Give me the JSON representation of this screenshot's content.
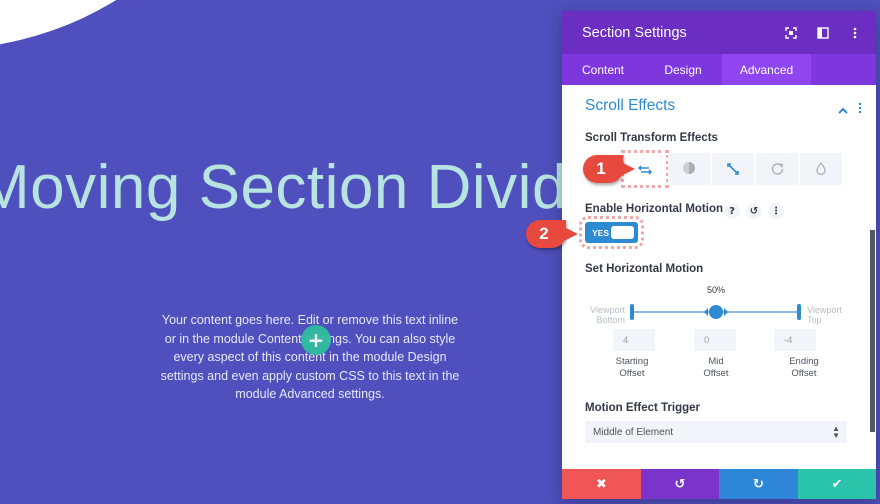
{
  "canvas": {
    "hero_title": "Moving Section Divide",
    "body_text": "Your content goes here. Edit or remove this text inline or in the module Content settings. You can also style every aspect of this content in the module Design settings and even apply custom CSS to this text in the module Advanced settings.",
    "add_icon": "plus-icon",
    "colors": {
      "background": "#4f4fbd",
      "title": "#b7e3e0"
    }
  },
  "panel": {
    "title": "Section Settings",
    "header_icons": [
      "expand-icon",
      "sidebar-layout-icon",
      "more-vertical-icon"
    ],
    "tabs": [
      {
        "label": "Content",
        "active": false
      },
      {
        "label": "Design",
        "active": false
      },
      {
        "label": "Advanced",
        "active": true
      }
    ],
    "section_title": "Scroll Effects",
    "scroll_transform_label": "Scroll Transform Effects",
    "effects": [
      {
        "name": "horizontal-motion-icon",
        "active": true
      },
      {
        "name": "fading-icon",
        "active": false
      },
      {
        "name": "scaling-icon",
        "active": false
      },
      {
        "name": "rotating-icon",
        "active": false
      },
      {
        "name": "blur-icon",
        "active": false
      }
    ],
    "enable_label": "Enable Horizontal Motion",
    "enable_option_icons": {
      "help": "?",
      "reset": "↺",
      "more": "⋮"
    },
    "toggle": {
      "label": "YES",
      "value": true
    },
    "set_motion_label": "Set Horizontal Motion",
    "slider": {
      "mid_percent_label": "50%",
      "mid_position_pct": 50,
      "left_label_1": "Viewport",
      "left_label_2": "Bottom",
      "right_label_1": "Viewport",
      "right_label_2": "Top"
    },
    "offsets": [
      {
        "value": "4",
        "label_1": "Starting",
        "label_2": "Offset"
      },
      {
        "value": "0",
        "label_1": "Mid",
        "label_2": "Offset"
      },
      {
        "value": "-4",
        "label_1": "Ending",
        "label_2": "Offset"
      }
    ],
    "trigger_label": "Motion Effect Trigger",
    "trigger_value": "Middle of Element",
    "footer": {
      "cancel": "✖",
      "undo": "↺",
      "redo": "↻",
      "save": "✔"
    }
  },
  "annotations": [
    {
      "number": "1"
    },
    {
      "number": "2"
    }
  ]
}
